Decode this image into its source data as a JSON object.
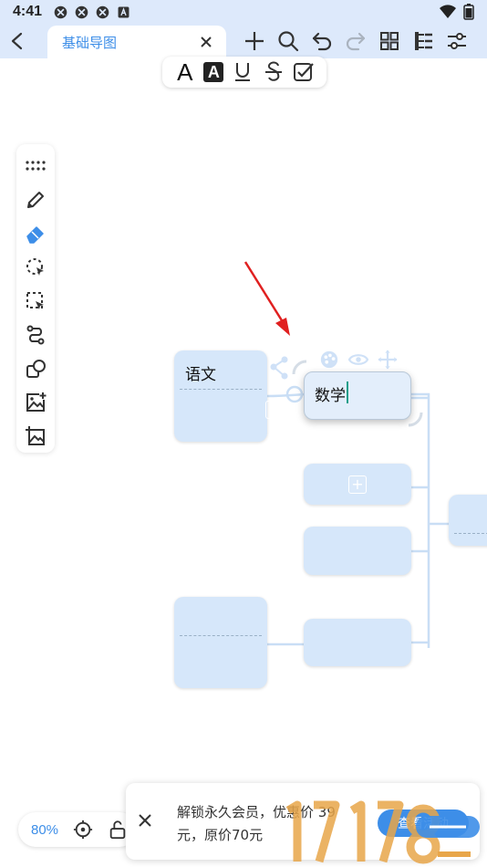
{
  "status_bar": {
    "time": "4:41"
  },
  "toolbar": {
    "tab_title": "基础导图",
    "icons": [
      "add-icon",
      "search-icon",
      "undo-icon",
      "redo-icon",
      "layout-icon",
      "structure-icon",
      "settings-icon"
    ]
  },
  "format_bar": {
    "bold_label": "A",
    "highlight_label": "A"
  },
  "tools": [
    "more-dots-icon",
    "pen-icon",
    "eraser-icon",
    "lasso-icon",
    "select-area-icon",
    "connector-icon",
    "shape-icon",
    "insert-image-icon",
    "image-icon"
  ],
  "mindmap": {
    "nodes": {
      "chinese": "语文",
      "math": "数学"
    }
  },
  "bottom": {
    "zoom": "80%",
    "promo_text": "解锁永久会员，优惠价 39 元，原价70元",
    "promo_button": "查看活动"
  },
  "colors": {
    "accent": "#3d8ee8",
    "node_fill": "#d6e7fa",
    "topbar": "#dde9fb"
  }
}
